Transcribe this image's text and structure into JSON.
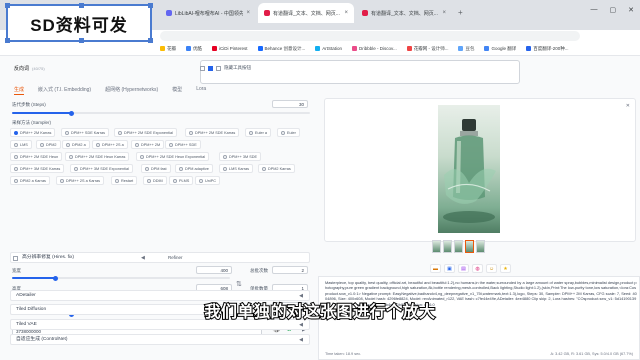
{
  "overlay": {
    "title": "SD资料可发"
  },
  "browser": {
    "tabs": [
      "LibLibAI-哩布哩布AI - 中国领先...",
      "有道翻译_文本、文档、网页...",
      "有道翻译_文本、文档、网页..."
    ],
    "bookmarks": [
      "花瓣",
      "优酷",
      "iCiDi Pinterest",
      "Behance 创意设计...",
      "ArtStation",
      "Dribbble - Discov...",
      "花瓣网 - 设计师...",
      "豆包",
      "Google 翻译",
      "百度翻译-200种..."
    ]
  },
  "header": {
    "neg_label": "反向词",
    "neg_count": "(40/75)",
    "opt_label": "隐藏工具按钮"
  },
  "tabs": [
    "生成",
    "嵌入式 (T.I. Embedding)",
    "超网络 (Hypernetworks)",
    "模型",
    "Lora"
  ],
  "sampling": {
    "steps_label": "迭代步数 (Steps)",
    "steps_value": "30",
    "steps_fraction": 0.2,
    "method_label": "采样方法 (Sampler)",
    "methods": [
      [
        "DPM++ 2M Karras",
        "DPM++ SDE Karras",
        "DPM++ 2M SDE Exponential",
        "DPM++ 2M SDE Karras",
        "Euler a",
        "Euler"
      ],
      [
        "LMS",
        "DPM2",
        "DPM2 a",
        "DPM++ 2S a",
        "DPM++ 2M",
        "DPM++ SDE"
      ],
      [
        "DPM++ 2M SDE Heun",
        "DPM++ 2M SDE Heun Karras",
        "DPM++ 2M SDE Heun Exponential",
        "DPM++ 3M SDE"
      ],
      [
        "DPM++ 3M SDE Karras",
        "DPM++ 3M SDE Exponential",
        "DPM fast",
        "DPM adaptive",
        "LMS Karras",
        "DPM2 Karras"
      ],
      [
        "DPM2 a Karras",
        "DPM++ 2S a Karras",
        "Restart",
        "DDIM",
        "PLMS",
        "UniPC"
      ]
    ],
    "selected": "DPM++ 2M Karras"
  },
  "hires": {
    "label": "高分辨率修复 (Hires. fix)",
    "refiner": "Refiner"
  },
  "size": {
    "width_label": "宽度",
    "width_value": "400",
    "width_fraction": 0.2,
    "height_label": "高度",
    "height_value": "608",
    "height_fraction": 0.28,
    "batch_count_label": "总批次数",
    "batch_count_value": "2",
    "batch_size_label": "单批数量",
    "batch_size_value": "1",
    "cfg_label": "提示词引导系数 (CFG Scale)",
    "cfg_value": "7",
    "cfg_fraction": 0.2,
    "seed_label": "随机数种子 (Seed)",
    "seed_value": "3738000000"
  },
  "sections": [
    "ADetailer",
    "Tiled Diffusion",
    "Tiled VAE",
    "自适应生成 (ControlNet)"
  ],
  "output": {
    "info": "Masterpiece, top quality, best quality, official art, beautiful and beautiful:1.2),no humans,in the water,surrounded by a large amount of water spray,bubbles,minimalist design,product photography,pure green gradient background,high saturation,8k,bottle rendering,mesh-controlled,Back lighting,Studio light:1.2),(skin,Print:The low-purity tone,low saturation,<lora:Cosproduct.sxw_v1.0:1>",
    "info2": "Negative prompt: EasyNegative,badhandv4,ng_deepnegative_v1_75t,watermark,text:1.3),logo,",
    "info3": "Steps: 30, Sampler: DPM++ 2M Karras, CFG scale: 7, Seed: 4004896, Size: 400x608, Model hash: 4296fe8824, Model: revAnimated_r122, VAE hash: c7fe44e49e,ADetailer: 4ee4880 Clip skip: 2, Lora hashes: \"COsproduct.sxw_v1: 5d1419013977\", TI hashes: \"EasyNegative: c74b4e810b03\", Version: v1.6.0",
    "time": "Time taken: 18.9 sec.",
    "mem": "A: 3.42 GB, R: 3.61 GB, Sys: 5.0/4.0 GB (67.7%)"
  },
  "caption": "我们单独的对这张图进行个放大"
}
